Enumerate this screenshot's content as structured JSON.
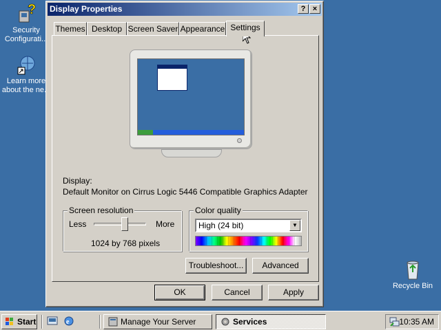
{
  "desktop": {
    "icons": [
      {
        "label_line1": "Security",
        "label_line2": "Configurati...",
        "icon": "security-config-icon"
      },
      {
        "label_line1": "Learn more",
        "label_line2": "about the ne...",
        "icon": "shortcut-globe-icon"
      },
      {
        "label_line1": "Recycle Bin",
        "label_line2": "",
        "icon": "recycle-bin-icon"
      }
    ]
  },
  "dialog": {
    "title": "Display Properties",
    "help_button": "?",
    "close_button": "×",
    "tabs": [
      "Themes",
      "Desktop",
      "Screen Saver",
      "Appearance",
      "Settings"
    ],
    "active_tab": "Settings",
    "display_label": "Display:",
    "display_value": "Default Monitor on Cirrus Logic 5446 Compatible Graphics Adapter",
    "resolution": {
      "group_title": "Screen resolution",
      "less": "Less",
      "more": "More",
      "value_text": "1024 by 768 pixels",
      "slider_fraction": 0.6
    },
    "color_quality": {
      "group_title": "Color quality",
      "selected": "High (24 bit)"
    },
    "buttons": {
      "troubleshoot": "Troubleshoot...",
      "advanced": "Advanced",
      "ok": "OK",
      "cancel": "Cancel",
      "apply": "Apply"
    }
  },
  "taskbar": {
    "start_label": "Start",
    "tasks": [
      {
        "label": "Manage Your Server",
        "active": false
      },
      {
        "label": "Services",
        "active": true
      }
    ],
    "clock": "10:35 AM"
  },
  "colors": {
    "desktop": "#3a6ea5",
    "title_active_start": "#0a246a",
    "title_active_end": "#a6caf0",
    "face": "#d4d0c8"
  }
}
